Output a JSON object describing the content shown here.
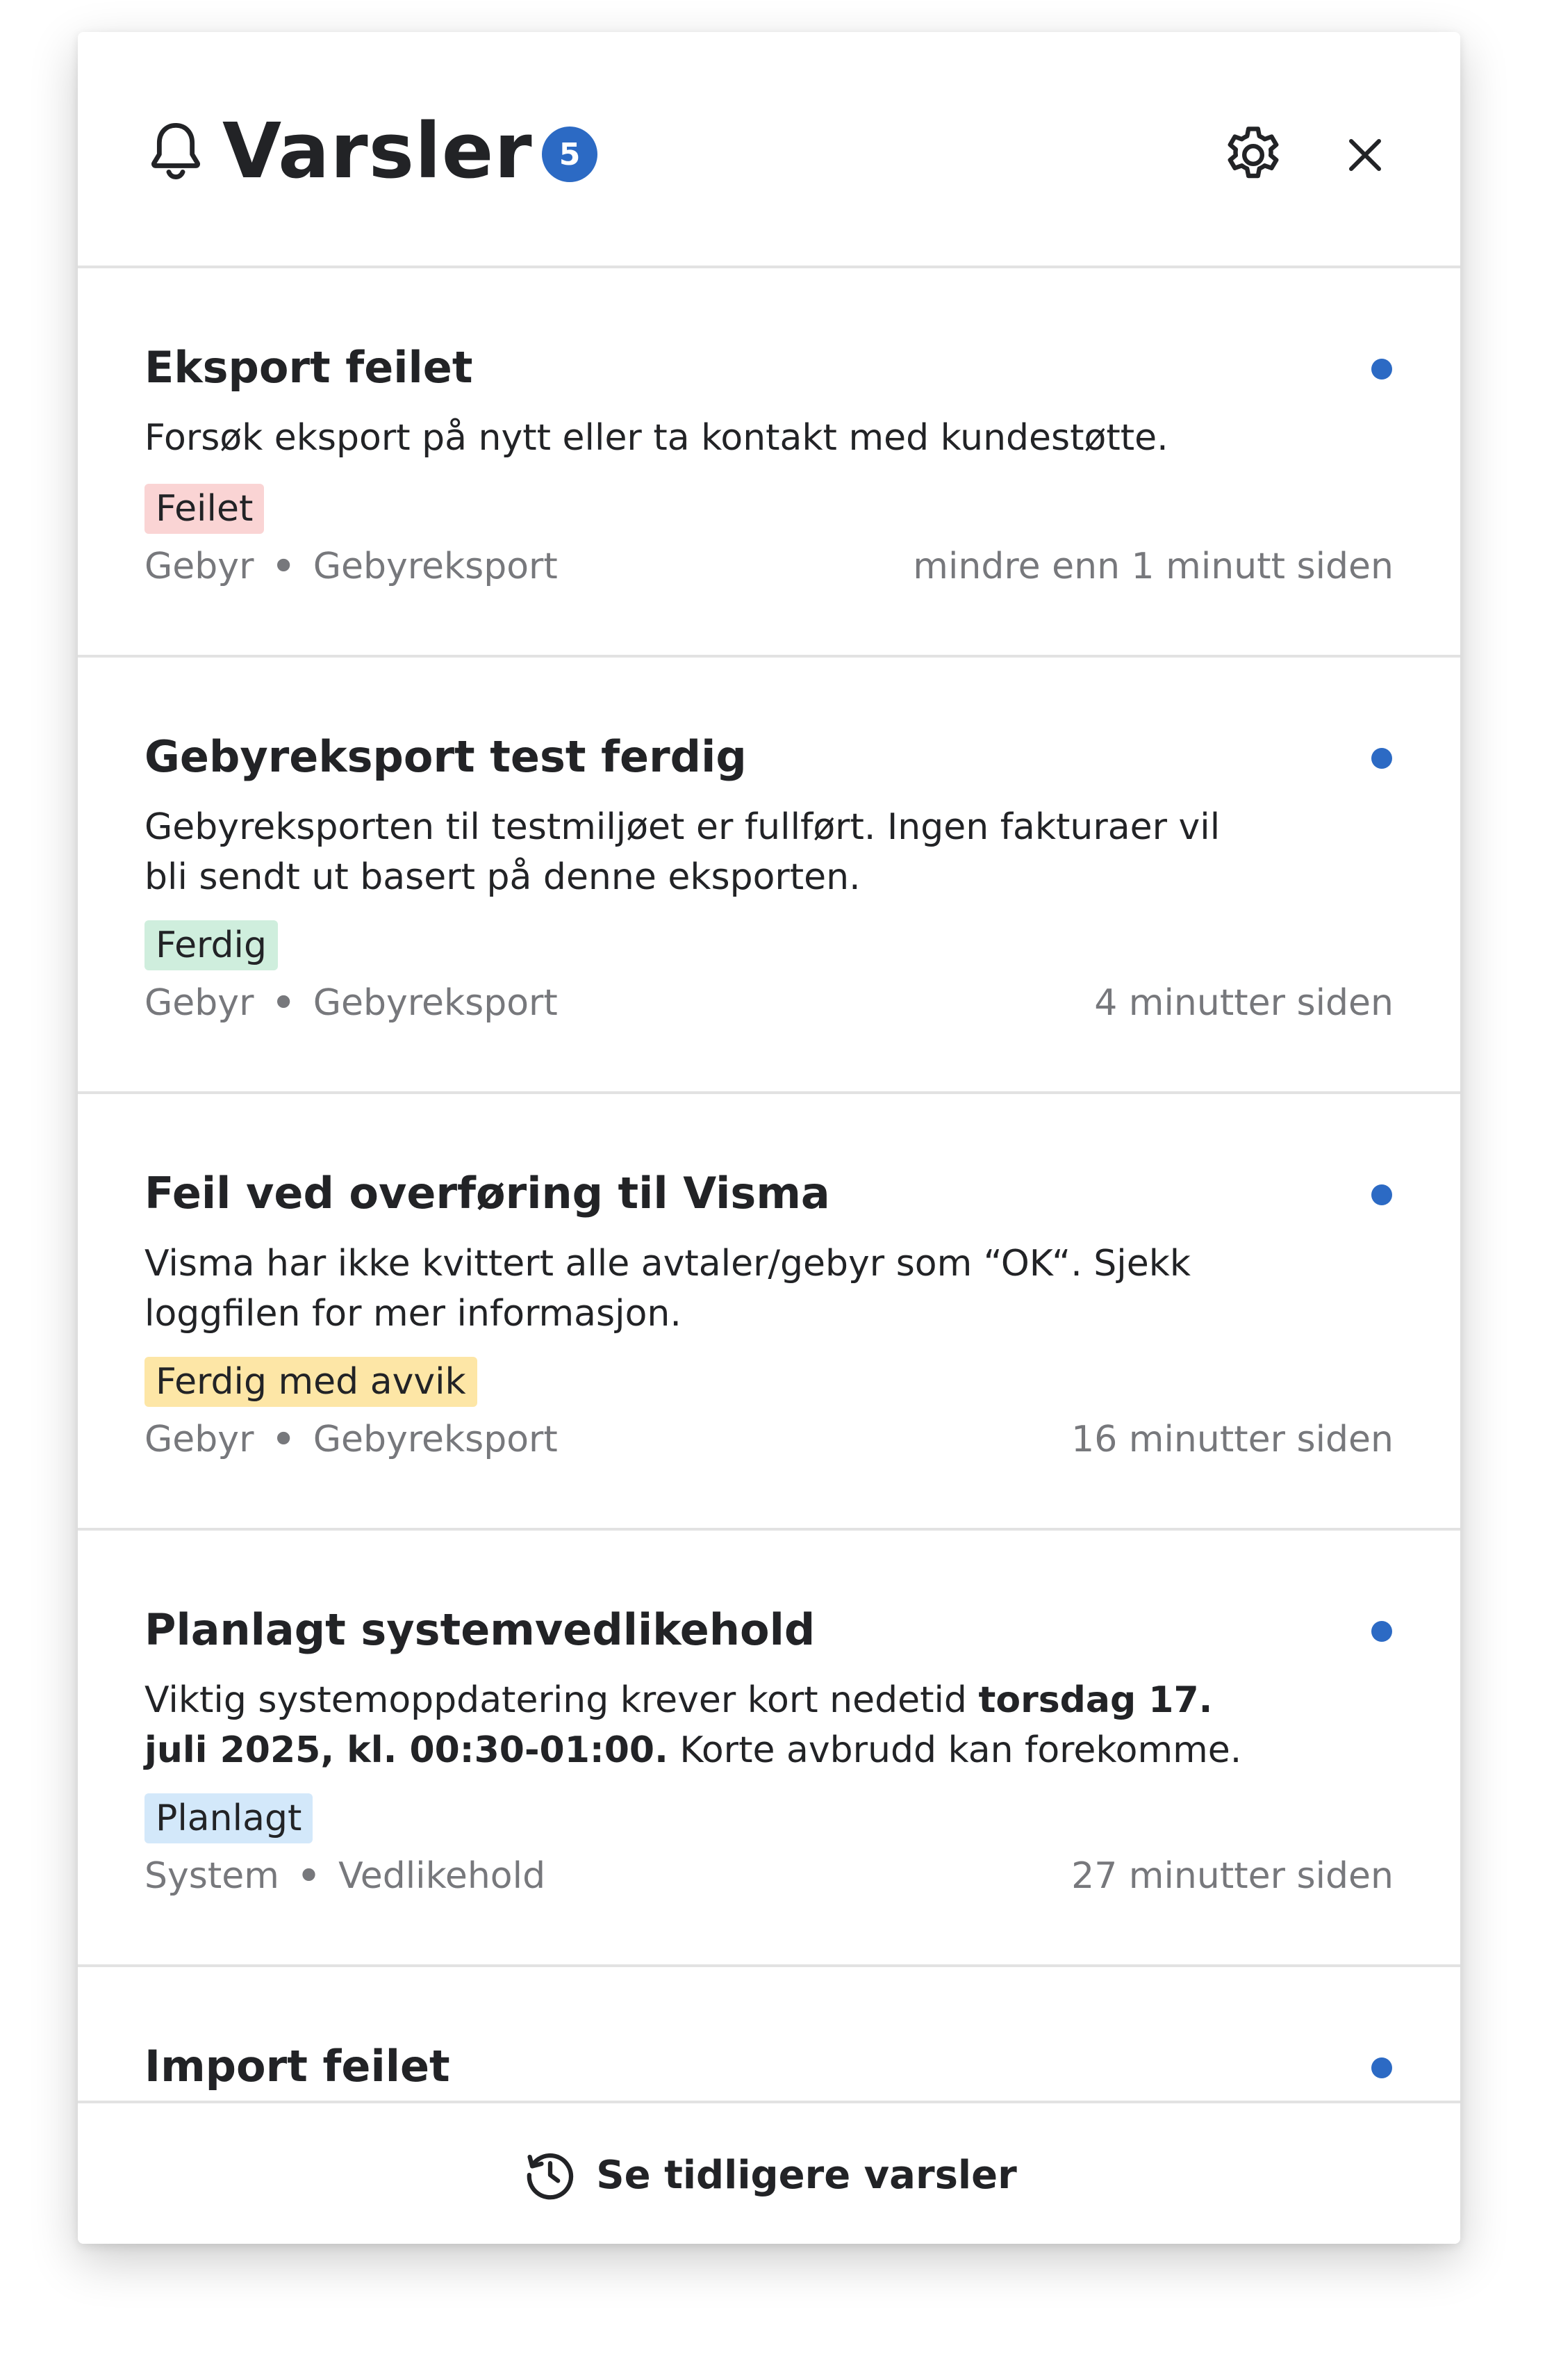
{
  "header": {
    "title": "Varsler",
    "unread_count": "5"
  },
  "notifications": [
    {
      "title": "Eksport feilet",
      "description": "Forsøk eksport på nytt eller ta kontakt med kundestøtte.",
      "status": "Feilet",
      "status_color": "#fad4d4",
      "category": "Gebyr",
      "source": "Gebyreksport",
      "time": "mindre enn 1 minutt siden",
      "unread": true
    },
    {
      "title": "Gebyreksport test ferdig",
      "description": "Gebyreksporten til testmiljøet er fullført. Ingen fakturaer vil bli sendt ut basert på denne eksporten.",
      "status": "Ferdig",
      "status_color": "#cfeedd",
      "category": "Gebyr",
      "source": "Gebyreksport",
      "time": "4 minutter siden",
      "unread": true
    },
    {
      "title": "Feil ved overføring til Visma",
      "description": "Visma har ikke kvittert alle avtaler/gebyr som “OK“. Sjekk loggfilen for mer informasjon.",
      "status": "Ferdig med avvik",
      "status_color": "#fde6a6",
      "category": "Gebyr",
      "source": "Gebyreksport",
      "time": "16 minutter siden",
      "unread": true
    },
    {
      "title": "Planlagt systemvedlikehold",
      "description_before": "Viktig systemoppdatering krever kort nedetid",
      "description_bold": "torsdag 17. juli 2025, kl. 00:30-01:00.",
      "description_after": "Korte avbrudd kan forekomme.",
      "status": "Planlagt",
      "status_color": "#d3e8fa",
      "category": "System",
      "source": "Vedlikehold",
      "time": "27 minutter siden",
      "unread": true
    },
    {
      "title": "Import feilet",
      "unread": true
    }
  ],
  "footer": {
    "history_label": "Se tidligere varsler"
  },
  "colors": {
    "accent": "#2c6ac4",
    "text": "#222326",
    "muted": "#77787c",
    "divider": "#e2e2e2"
  }
}
